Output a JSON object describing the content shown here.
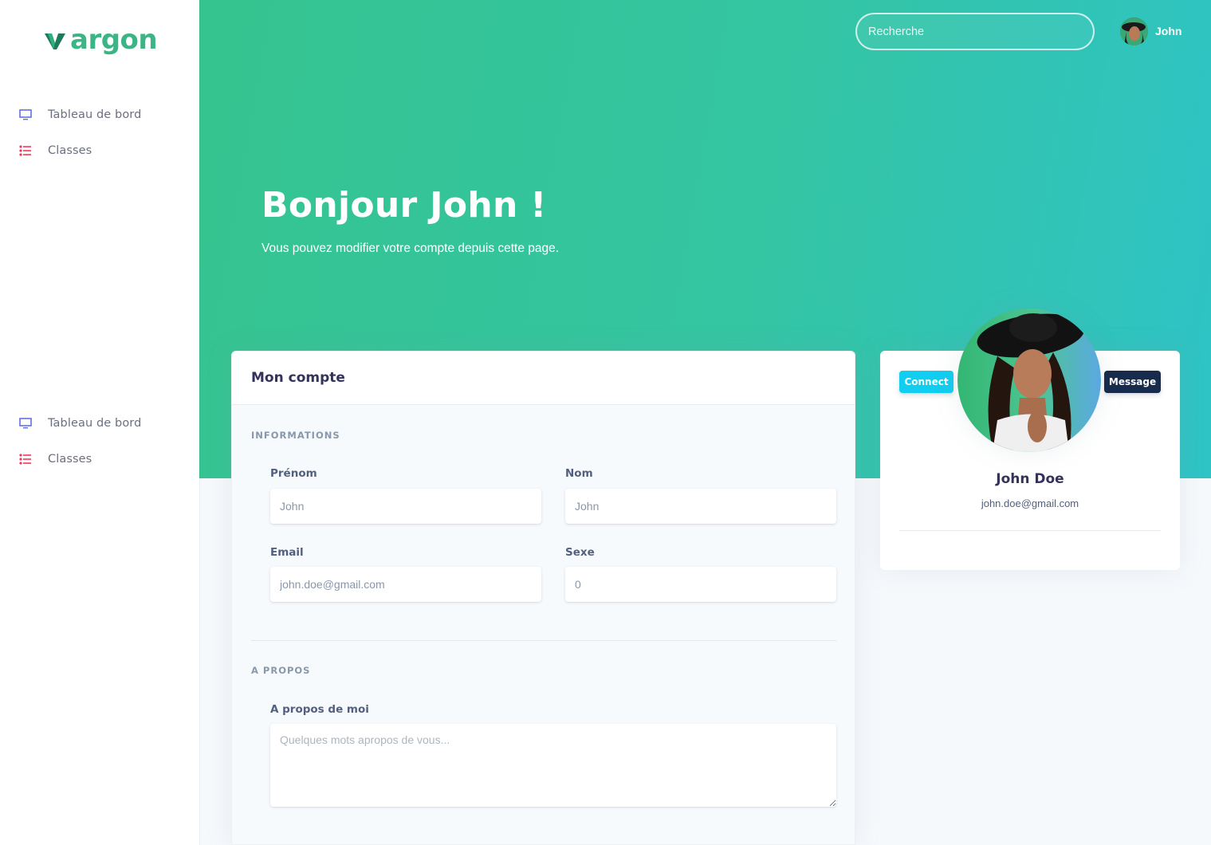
{
  "brand": {
    "name": "argon",
    "color": "#3bb585"
  },
  "sidebar": {
    "groups": [
      {
        "items": [
          {
            "label": "Tableau de bord",
            "icon": "monitor-icon"
          },
          {
            "label": "Classes",
            "icon": "list-icon"
          }
        ]
      },
      {
        "items": [
          {
            "label": "Tableau de bord",
            "icon": "monitor-icon"
          },
          {
            "label": "Classes",
            "icon": "list-icon"
          }
        ]
      }
    ]
  },
  "header": {
    "search_placeholder": "Recherche",
    "user_name": "John"
  },
  "hero": {
    "title": "Bonjour John !",
    "subtitle": "Vous pouvez modifier votre compte depuis cette page."
  },
  "account": {
    "title": "Mon compte",
    "section_info": "INFORMATIONS",
    "fields": {
      "prenom": {
        "label": "Prénom",
        "placeholder": "John"
      },
      "nom": {
        "label": "Nom",
        "placeholder": "John"
      },
      "email": {
        "label": "Email",
        "placeholder": "john.doe@gmail.com"
      },
      "sexe": {
        "label": "Sexe",
        "placeholder": "0"
      }
    },
    "section_about": "A PROPOS",
    "about": {
      "label": "A propos de moi",
      "placeholder": "Quelques mots apropos de vous..."
    }
  },
  "profile": {
    "connect_label": "Connect",
    "message_label": "Message",
    "name": "John Doe",
    "email": "john.doe@gmail.com"
  },
  "colors": {
    "hero_start": "#35c48f",
    "hero_end": "#2ec3c6",
    "connect": "#11cdef",
    "message": "#172b4d"
  }
}
